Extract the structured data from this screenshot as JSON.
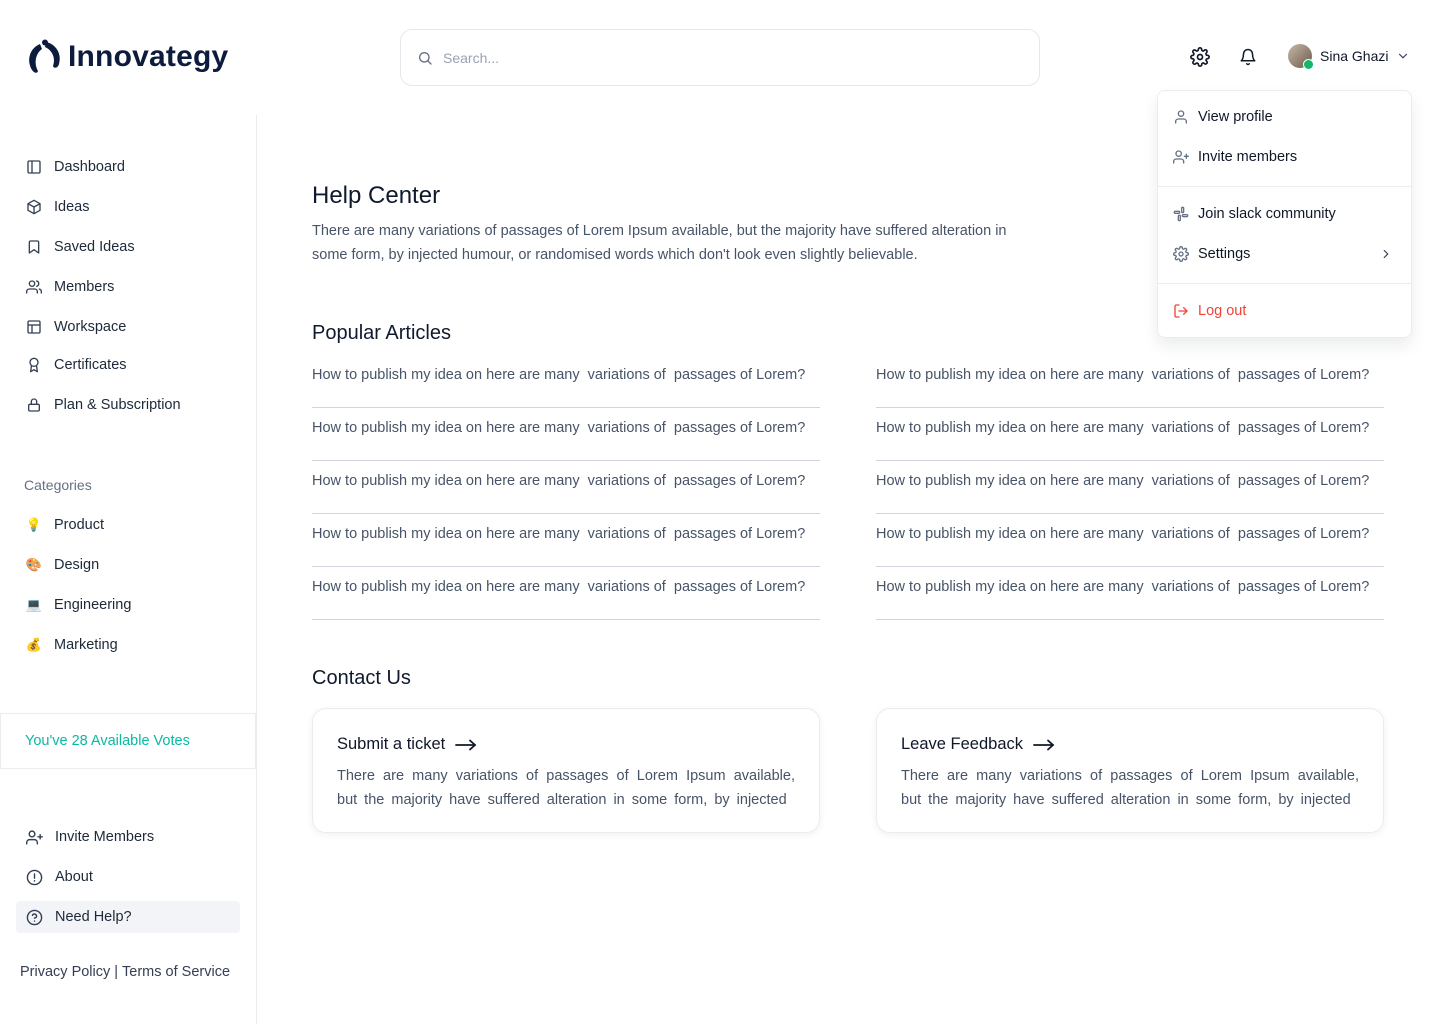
{
  "brand": {
    "name": "Innovategy"
  },
  "search": {
    "placeholder": "Search..."
  },
  "header": {
    "user_name": "Sina Ghazi"
  },
  "sidebar": {
    "nav": [
      {
        "label": "Dashboard",
        "icon": "sidebar-layout-icon"
      },
      {
        "label": "Ideas",
        "icon": "cube-icon"
      },
      {
        "label": "Saved Ideas",
        "icon": "bookmark-icon"
      },
      {
        "label": "Members",
        "icon": "users-icon"
      },
      {
        "label": "Workspace",
        "icon": "layout-icon"
      },
      {
        "label": "Certificates",
        "icon": "award-icon"
      },
      {
        "label": "Plan & Subscription",
        "icon": "lock-icon"
      }
    ],
    "categories_title": "Categories",
    "categories": [
      {
        "label": "Product",
        "emoji": "💡"
      },
      {
        "label": "Design",
        "emoji": "🎨"
      },
      {
        "label": "Engineering",
        "emoji": "💻"
      },
      {
        "label": "Marketing",
        "emoji": "💰"
      }
    ],
    "votes_text": "You've 28 Available Votes",
    "bottom": [
      {
        "label": "Invite Members",
        "icon": "user-plus-icon"
      },
      {
        "label": "About",
        "icon": "info-circle-icon"
      },
      {
        "label": "Need Help?",
        "icon": "help-circle-icon",
        "active": true
      }
    ],
    "legal": {
      "privacy": "Privacy Policy",
      "separator": "|",
      "terms": "Terms of Service"
    }
  },
  "main": {
    "title": "Help Center",
    "description": "There are many variations of passages of Lorem Ipsum available, but the majority have suffered alteration in some form, by injected humour, or randomised words which don't look even slightly believable.",
    "popular_title": "Popular Articles",
    "articles_left": [
      "How to publish my idea on here are many  variations of  passages of Lorem?",
      "How to publish my idea on here are many  variations of  passages of Lorem?",
      "How to publish my idea on here are many  variations of  passages of Lorem?",
      "How to publish my idea on here are many  variations of  passages of Lorem?",
      "How to publish my idea on here are many  variations of  passages of Lorem?"
    ],
    "articles_right": [
      "How to publish my idea on here are many  variations of  passages of Lorem?",
      "How to publish my idea on here are many  variations of  passages of Lorem?",
      "How to publish my idea on here are many  variations of  passages of Lorem?",
      "How to publish my idea on here are many  variations of  passages of Lorem?",
      "How to publish my idea on here are many  variations of  passages of Lorem?"
    ],
    "contact_title": "Contact Us",
    "cards": [
      {
        "title": "Submit a ticket",
        "body": "There are many variations of passages of Lorem Ipsum available, but the majority have suffered alteration in some form, by injected"
      },
      {
        "title": "Leave Feedback",
        "body": "There are many variations of passages of Lorem Ipsum available, but the majority have suffered alteration in some form, by injected"
      }
    ]
  },
  "user_menu": {
    "view_profile": "View profile",
    "invite_members": "Invite members",
    "join_slack": "Join slack community",
    "settings": "Settings",
    "log_out": "Log out"
  },
  "colors": {
    "accent_teal": "#0bb8a3",
    "danger": "#f04438",
    "text_dark": "#0f1a2e",
    "text_muted": "#475467"
  }
}
